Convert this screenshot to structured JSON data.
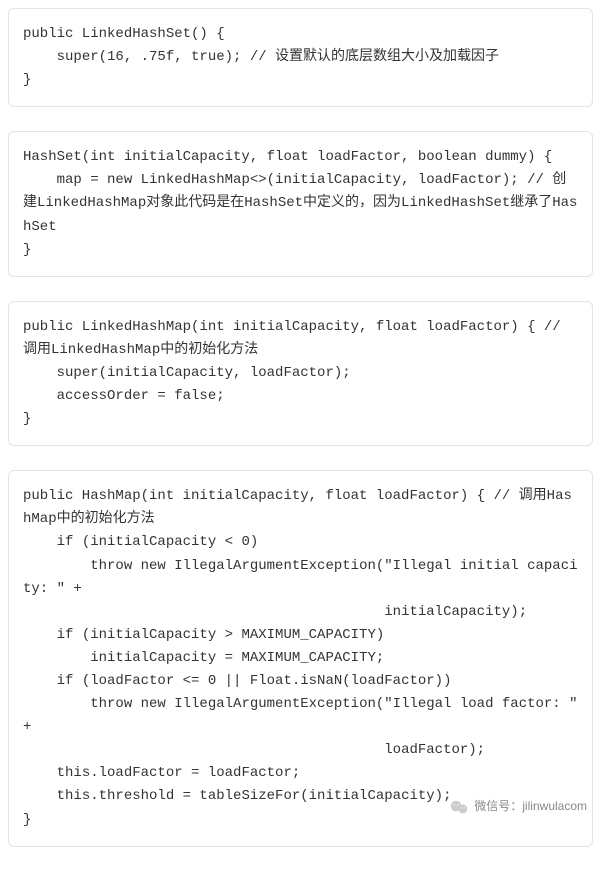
{
  "blocks": [
    {
      "code": "public LinkedHashSet() {\n    super(16, .75f, true); // 设置默认的底层数组大小及加载因子\n}"
    },
    {
      "code": "HashSet(int initialCapacity, float loadFactor, boolean dummy) {\n    map = new LinkedHashMap<>(initialCapacity, loadFactor); // 创建LinkedHashMap对象此代码是在HashSet中定义的，因为LinkedHashSet继承了HashSet\n}"
    },
    {
      "code": "public LinkedHashMap(int initialCapacity, float loadFactor) { // 调用LinkedHashMap中的初始化方法\n    super(initialCapacity, loadFactor);\n    accessOrder = false;\n}"
    },
    {
      "code": "public HashMap(int initialCapacity, float loadFactor) { // 调用HashMap中的初始化方法\n    if (initialCapacity < 0)\n        throw new IllegalArgumentException(\"Illegal initial capacity: \" +\n                                           initialCapacity);\n    if (initialCapacity > MAXIMUM_CAPACITY)\n        initialCapacity = MAXIMUM_CAPACITY;\n    if (loadFactor <= 0 || Float.isNaN(loadFactor))\n        throw new IllegalArgumentException(\"Illegal load factor: \" +\n                                           loadFactor);\n    this.loadFactor = loadFactor;\n    this.threshold = tableSizeFor(initialCapacity);\n}"
    }
  ],
  "watermark": {
    "label": "微信号：",
    "id": "jilinwulacom"
  }
}
